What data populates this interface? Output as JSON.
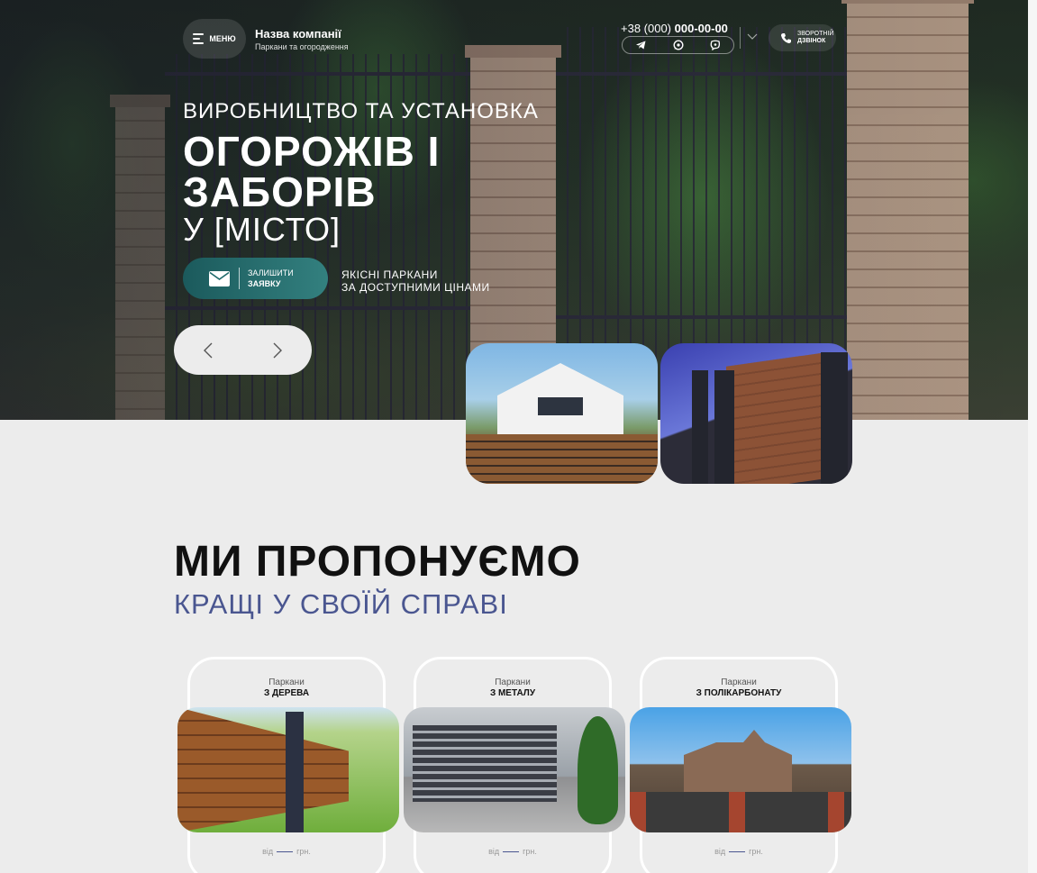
{
  "header": {
    "menu_label": "МЕНЮ",
    "company_name": "Назва компанії",
    "company_sub": "Паркани та огородження",
    "phone_prefix": "+38 (000)",
    "phone_number": "000-00-00",
    "callback_line1": "ЗВОРОТНІЙ",
    "callback_line2": "ДЗВІНОК"
  },
  "hero": {
    "pre_title": "ВИРОБНИЦТВО ТА УСТАНОВКА",
    "title_line1": "ОГОРОЖІВ І",
    "title_line2": "ЗАБОРІВ",
    "city": "У [МІСТО]",
    "cta_line1": "ЗАЛИШИТИ",
    "cta_line2": "ЗАЯВКУ",
    "slogan_line1": "ЯКІСНІ ПАРКАНИ",
    "slogan_line2": "ЗА ДОСТУПНИМИ ЦІНАМИ"
  },
  "section": {
    "title": "МИ ПРОПОНУЄМО",
    "subtitle": "КРАЩІ У СВОЇЙ СПРАВІ"
  },
  "cards": [
    {
      "category": "Паркани",
      "name": "З ДЕРЕВА",
      "price_from": "від",
      "price_unit": "грн."
    },
    {
      "category": "Паркани",
      "name": "З МЕТАЛУ",
      "price_from": "від",
      "price_unit": "грн."
    },
    {
      "category": "Паркани",
      "name": "З ПОЛІКАРБОНАТУ",
      "price_from": "від",
      "price_unit": "грн."
    }
  ],
  "colors": {
    "accent": "#33807f",
    "subtitle": "#4a5690",
    "background": "#ececec"
  },
  "icons": [
    "menu-icon",
    "telegram-icon",
    "whatsapp-icon",
    "viber-icon",
    "chevron-down-icon",
    "phone-icon",
    "mail-icon",
    "arrow-left-icon",
    "arrow-right-icon"
  ]
}
